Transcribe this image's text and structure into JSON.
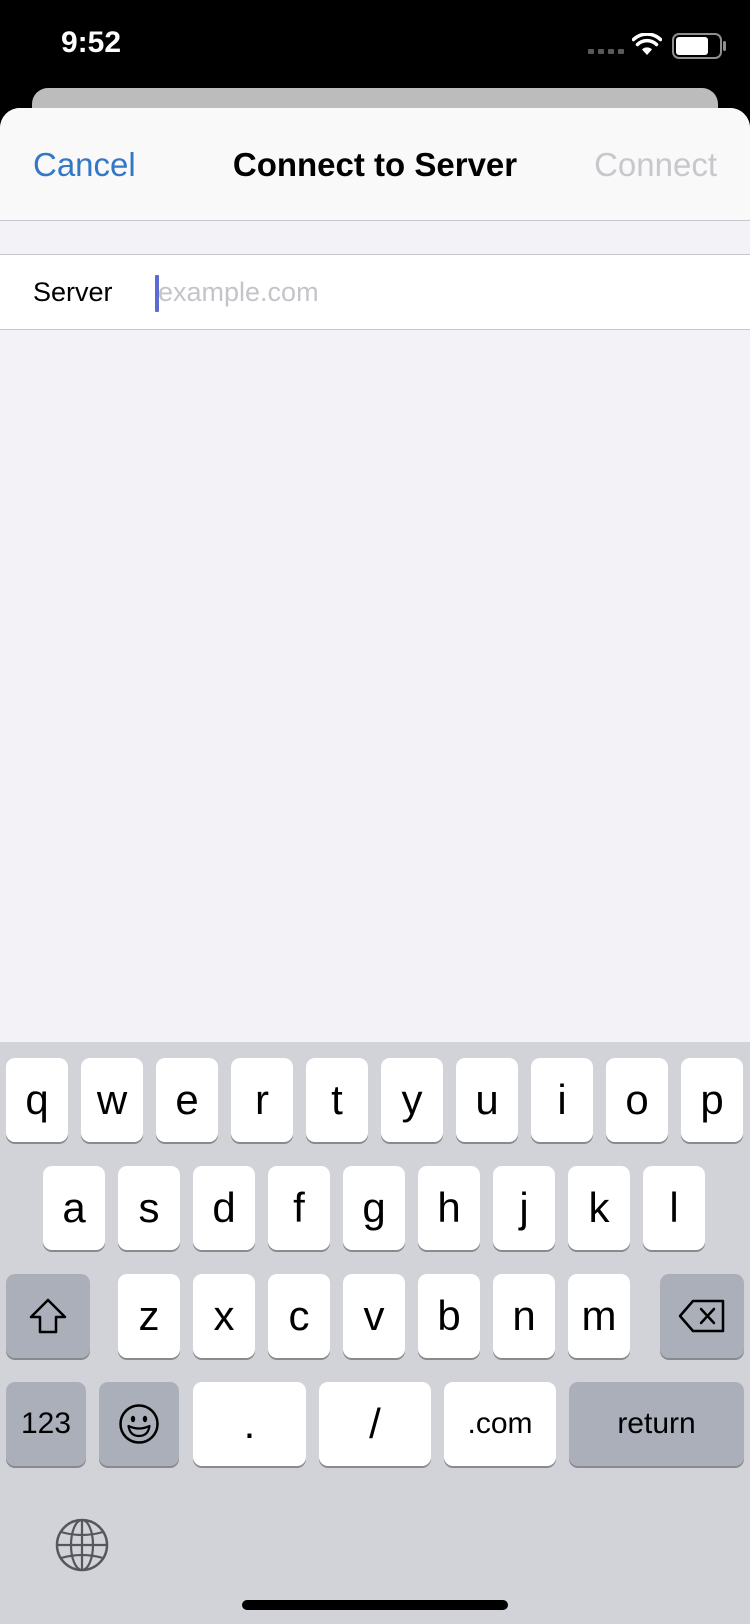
{
  "status_bar": {
    "time": "9:52"
  },
  "dialog": {
    "cancel_label": "Cancel",
    "title": "Connect to Server",
    "connect_label": "Connect",
    "field_label": "Server",
    "field_value": "",
    "field_placeholder": "example.com"
  },
  "keyboard": {
    "row1": [
      "q",
      "w",
      "e",
      "r",
      "t",
      "y",
      "u",
      "i",
      "o",
      "p"
    ],
    "row2": [
      "a",
      "s",
      "d",
      "f",
      "g",
      "h",
      "j",
      "k",
      "l"
    ],
    "row3": [
      "z",
      "x",
      "c",
      "v",
      "b",
      "n",
      "m"
    ],
    "numbers_label": "123",
    "dot_label": ".",
    "slash_label": "/",
    "dotcom_label": ".com",
    "return_label": "return",
    "icons": [
      "shift-icon",
      "backspace-icon",
      "emoji-icon",
      "globe-icon"
    ]
  },
  "colors": {
    "accent": "#3478c5",
    "disabled": "#c7c7cc",
    "caret": "#5b6bd1"
  }
}
